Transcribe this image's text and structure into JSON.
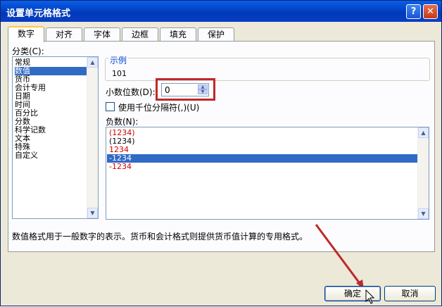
{
  "dialog": {
    "title": "设置单元格格式",
    "help_label": "?",
    "close_label": "✕"
  },
  "tabs": [
    {
      "label": "数字",
      "active": true
    },
    {
      "label": "对齐"
    },
    {
      "label": "字体"
    },
    {
      "label": "边框"
    },
    {
      "label": "填充"
    },
    {
      "label": "保护"
    }
  ],
  "category": {
    "label": "分类(C):",
    "items": [
      "常规",
      "数值",
      "货币",
      "会计专用",
      "日期",
      "时间",
      "百分比",
      "分数",
      "科学记数",
      "文本",
      "特殊",
      "自定义"
    ],
    "selected": "数值"
  },
  "sample": {
    "label": "示例",
    "value": "101"
  },
  "decimal_places": {
    "label": "小数位数(D):",
    "value": "0"
  },
  "thousands_separator": {
    "label": "使用千位分隔符(,)(U)",
    "checked": false
  },
  "negative_numbers": {
    "label": "负数(N):",
    "items": [
      {
        "text": "(1234)",
        "color": "#d00000"
      },
      {
        "text": "(1234)",
        "color": "#000000"
      },
      {
        "text": "1234",
        "color": "#d00000"
      },
      {
        "text": "-1234",
        "color": "#000000",
        "selected": true
      },
      {
        "text": "-1234",
        "color": "#d00000"
      }
    ]
  },
  "description": "数值格式用于一般数字的表示。货币和会计格式则提供货币值计算的专用格式。",
  "buttons": {
    "ok": "确定",
    "cancel": "取消"
  },
  "colors": {
    "title_bar": "#0a5fe8",
    "selection": "#316ac5",
    "highlight_frame": "#c0282a",
    "negative_red": "#d00000"
  }
}
